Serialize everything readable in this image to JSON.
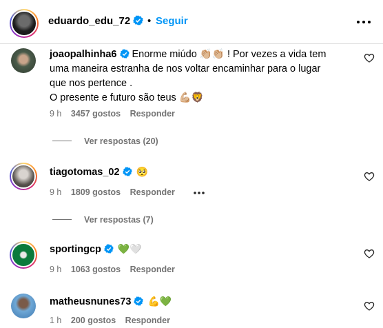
{
  "header": {
    "username": "eduardo_edu_72",
    "separator": "•",
    "follow_label": "Seguir",
    "more_icon": "more-horizontal-icon"
  },
  "comments": [
    {
      "username": "joaopalhinha6",
      "verified": true,
      "line1": "Enorme miúdo 👏🏼👏🏼 ! Por vezes a vida tem",
      "line2": "uma maneira estranha de nos voltar encaminhar para o lugar",
      "line3": "que nos pertence .",
      "line4": "O presente e futuro são teus 💪🏼🦁",
      "time": "9 h",
      "likes": "3457 gostos",
      "reply_label": "Responder",
      "replies_label": "Ver respostas (20)"
    },
    {
      "username": "tiagotomas_02",
      "verified": true,
      "text": "🥺",
      "time": "9 h",
      "likes": "1809 gostos",
      "reply_label": "Responder",
      "replies_label": "Ver respostas (7)"
    },
    {
      "username": "sportingcp",
      "verified": true,
      "text": "💚🤍",
      "time": "9 h",
      "likes": "1063 gostos",
      "reply_label": "Responder"
    },
    {
      "username": "matheusnunes73",
      "verified": true,
      "text": "💪💚",
      "time": "1 h",
      "likes": "200 gostos",
      "reply_label": "Responder"
    }
  ],
  "colors": {
    "link_blue": "#0095f6",
    "verified_blue": "#0095f6",
    "meta_gray": "#737373",
    "divider": "#dbdbdb"
  },
  "icons": {
    "heart": "heart-outline-icon",
    "verified": "verified-badge-icon"
  }
}
